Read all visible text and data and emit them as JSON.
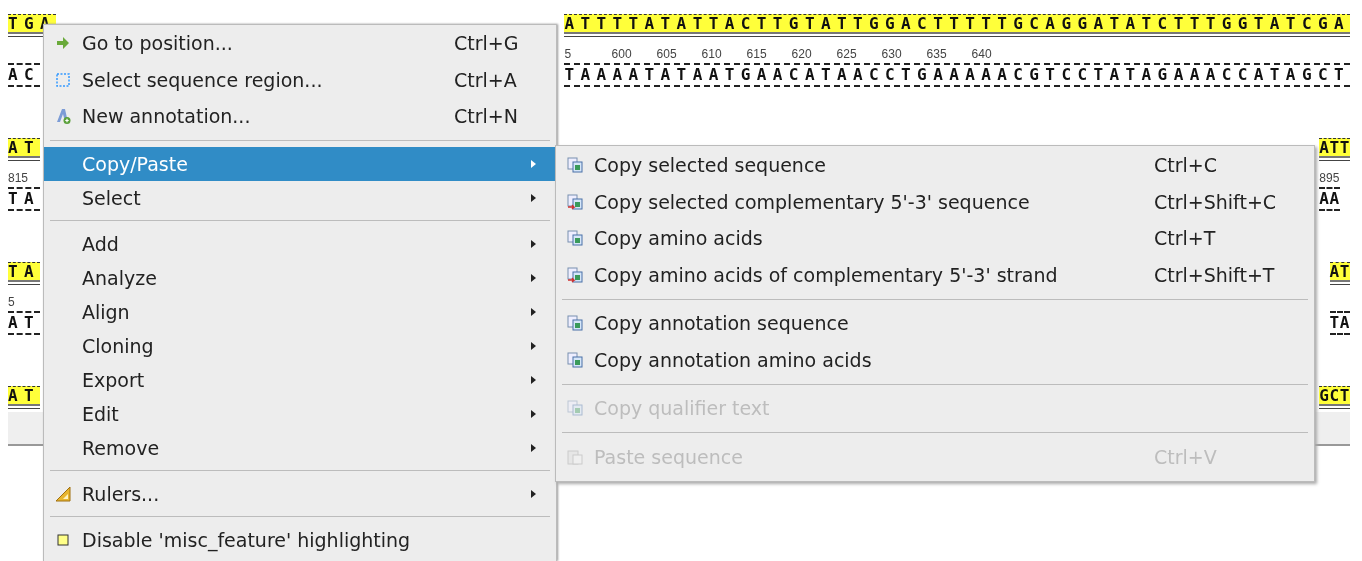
{
  "sequence_rows": [
    {
      "left": {
        "strand": "TGA",
        "complement": "AC"
      },
      "right": {
        "strand": "ATTTTATATTACTTGTATTGGACTTTTTGCAGGATATCTTTGGTATCGA",
        "ruler": [
          "5",
          "600",
          "605",
          "610",
          "615",
          "620",
          "625",
          "630",
          "635",
          "640"
        ],
        "complement": "TAAAATATAATGAACATAACCTGAAAAACGTCCTATAGAAACCATAGCT"
      }
    },
    {
      "left": {
        "strand": "AT",
        "ruler": [
          "815"
        ],
        "complement": "TA"
      },
      "right": {
        "strand": "ATT",
        "ruler": [
          "895"
        ],
        "complement": "AA"
      }
    },
    {
      "left": {
        "strand": "TA",
        "ruler": [
          "5"
        ],
        "complement": "AT"
      },
      "right": {
        "strand": "AT",
        "complement": "TA"
      }
    },
    {
      "left": {
        "strand": "AT"
      },
      "right": {
        "strand": "GCT"
      }
    }
  ],
  "context_menu": {
    "items": [
      {
        "kind": "item",
        "label": "Go to position...",
        "shortcut": "Ctrl+G",
        "submenu": false,
        "selected": false
      },
      {
        "kind": "item",
        "label": "Select sequence region...",
        "shortcut": "Ctrl+A",
        "submenu": false,
        "selected": false
      },
      {
        "kind": "item",
        "label": "New annotation...",
        "shortcut": "Ctrl+N",
        "submenu": false,
        "selected": false
      },
      {
        "kind": "separator"
      },
      {
        "kind": "item",
        "label": "Copy/Paste",
        "submenu": true,
        "selected": true
      },
      {
        "kind": "item",
        "label": "Select",
        "submenu": true,
        "selected": false
      },
      {
        "kind": "separator"
      },
      {
        "kind": "item",
        "label": "Add",
        "submenu": true,
        "selected": false
      },
      {
        "kind": "item",
        "label": "Analyze",
        "submenu": true,
        "selected": false
      },
      {
        "kind": "item",
        "label": "Align",
        "submenu": true,
        "selected": false
      },
      {
        "kind": "item",
        "label": "Cloning",
        "submenu": true,
        "selected": false
      },
      {
        "kind": "item",
        "label": "Export",
        "submenu": true,
        "selected": false
      },
      {
        "kind": "item",
        "label": "Edit",
        "submenu": true,
        "selected": false
      },
      {
        "kind": "item",
        "label": "Remove",
        "submenu": true,
        "selected": false
      },
      {
        "kind": "separator"
      },
      {
        "kind": "item",
        "label": "Rulers...",
        "submenu": true,
        "selected": false
      },
      {
        "kind": "separator"
      },
      {
        "kind": "item",
        "label": "Disable 'misc_feature' highlighting",
        "submenu": false,
        "selected": false
      }
    ]
  },
  "submenu": {
    "items": [
      {
        "kind": "item",
        "label": "Copy selected sequence",
        "shortcut": "Ctrl+C",
        "disabled": false
      },
      {
        "kind": "item",
        "label": "Copy selected complementary 5'-3' sequence",
        "shortcut": "Ctrl+Shift+C",
        "disabled": false
      },
      {
        "kind": "item",
        "label": "Copy amino acids",
        "shortcut": "Ctrl+T",
        "disabled": false
      },
      {
        "kind": "item",
        "label": "Copy amino acids of complementary 5'-3' strand",
        "shortcut": "Ctrl+Shift+T",
        "disabled": false
      },
      {
        "kind": "separator"
      },
      {
        "kind": "item",
        "label": "Copy annotation sequence",
        "disabled": false
      },
      {
        "kind": "item",
        "label": "Copy annotation amino acids",
        "disabled": false
      },
      {
        "kind": "separator"
      },
      {
        "kind": "item",
        "label": "Copy qualifier text",
        "disabled": true
      },
      {
        "kind": "separator"
      },
      {
        "kind": "item",
        "label": "Paste sequence",
        "shortcut": "Ctrl+V",
        "disabled": true
      }
    ]
  }
}
